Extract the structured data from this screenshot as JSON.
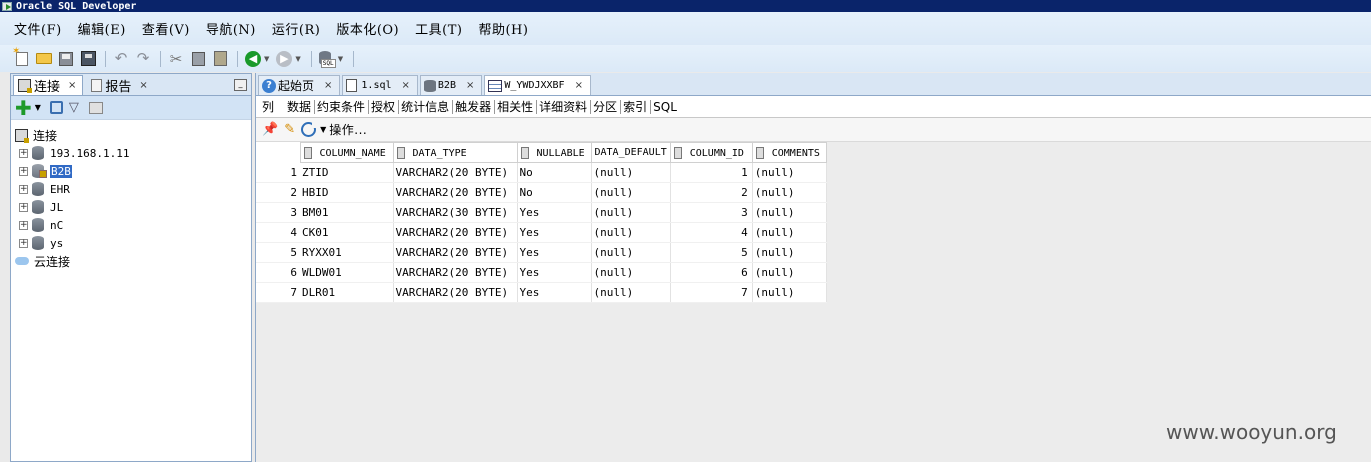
{
  "window": {
    "title": "Oracle SQL Developer"
  },
  "menu": [
    "文件(F)",
    "编辑(E)",
    "查看(V)",
    "导航(N)",
    "运行(R)",
    "版本化(O)",
    "工具(T)",
    "帮助(H)"
  ],
  "left_panel": {
    "tabs": [
      {
        "label": "连接",
        "close": "×"
      },
      {
        "label": "报告",
        "close": "×"
      }
    ],
    "tree": {
      "root": "连接",
      "connections": [
        "193.168.1.11",
        "B2B",
        "EHR",
        "JL",
        "nC",
        "ys"
      ],
      "selected": "B2B",
      "cloud": "云连接"
    }
  },
  "editor": {
    "tabs": [
      {
        "label": "起始页",
        "close": "×"
      },
      {
        "label": "1.sql",
        "close": "×"
      },
      {
        "label": "B2B",
        "close": "×"
      },
      {
        "label": "W_YWDJXXBF",
        "close": "×"
      }
    ],
    "subtabs": [
      "列",
      "数据",
      "约束条件",
      "授权",
      "统计信息",
      "触发器",
      "相关性",
      "详细资料",
      "分区",
      "索引",
      "SQL"
    ],
    "actions_label": "操作...",
    "table": {
      "columns": [
        "COLUMN_NAME",
        "DATA_TYPE",
        "NULLABLE",
        "DATA_DEFAULT",
        "COLUMN_ID",
        "COMMENTS"
      ],
      "rows": [
        [
          "1",
          "ZTID",
          "VARCHAR2(20 BYTE)",
          "No",
          "(null)",
          "1",
          "(null)"
        ],
        [
          "2",
          "HBID",
          "VARCHAR2(20 BYTE)",
          "No",
          "(null)",
          "2",
          "(null)"
        ],
        [
          "3",
          "BM01",
          "VARCHAR2(30 BYTE)",
          "Yes",
          "(null)",
          "3",
          "(null)"
        ],
        [
          "4",
          "CK01",
          "VARCHAR2(20 BYTE)",
          "Yes",
          "(null)",
          "4",
          "(null)"
        ],
        [
          "5",
          "RYXX01",
          "VARCHAR2(20 BYTE)",
          "Yes",
          "(null)",
          "5",
          "(null)"
        ],
        [
          "6",
          "WLDW01",
          "VARCHAR2(20 BYTE)",
          "Yes",
          "(null)",
          "6",
          "(null)"
        ],
        [
          "7",
          "DLR01",
          "VARCHAR2(20 BYTE)",
          "Yes",
          "(null)",
          "7",
          "(null)"
        ]
      ]
    }
  },
  "watermark": "www.wooyun.org",
  "colors": {
    "titlebar": "#0a246a",
    "selection": "#316ac5",
    "toolbar": "#dbe9f7"
  }
}
